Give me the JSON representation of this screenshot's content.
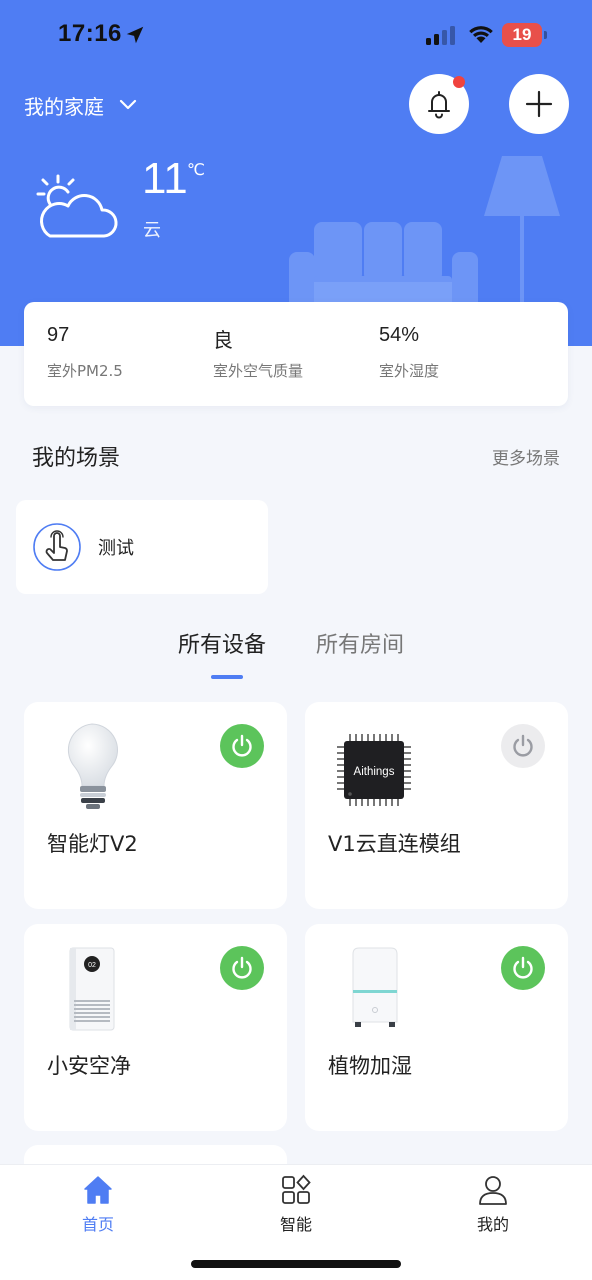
{
  "status_bar": {
    "time": "17:16",
    "battery": "19",
    "icons": [
      "location-arrow-icon",
      "signal-icon",
      "wifi-icon",
      "battery-icon"
    ]
  },
  "header": {
    "home_name": "我的家庭",
    "icons": [
      "chevron-down-icon",
      "bell-icon",
      "plus-icon"
    ],
    "notification_dot_color": "#f0433e"
  },
  "weather": {
    "temperature": "11",
    "unit": "℃",
    "description": "云",
    "icon": "partly-cloudy-icon"
  },
  "air_quality": [
    {
      "value": "97",
      "label": "室外PM2.5"
    },
    {
      "value": "良",
      "label": "室外空气质量"
    },
    {
      "value": "54%",
      "label": "室外湿度"
    }
  ],
  "scenes": {
    "title": "我的场景",
    "more": "更多场景",
    "items": [
      {
        "name": "测试",
        "icon": "tap-hand-icon"
      }
    ]
  },
  "tabs": {
    "devices": "所有设备",
    "rooms": "所有房间",
    "active": "devices"
  },
  "devices": [
    {
      "name": "智能灯V2",
      "image": "light-bulb",
      "power": "on"
    },
    {
      "name": "V1云直连模组",
      "image": "chip",
      "chip_label": "Aithings",
      "power": "off"
    },
    {
      "name": "小安空净",
      "image": "air-purifier",
      "display": "02",
      "power": "on"
    },
    {
      "name": "植物加湿",
      "image": "humidifier",
      "power": "on"
    }
  ],
  "bottom_nav": [
    {
      "label": "首页",
      "icon": "home-icon",
      "active": true
    },
    {
      "label": "智能",
      "icon": "grid-icon",
      "active": false
    },
    {
      "label": "我的",
      "icon": "user-icon",
      "active": false
    }
  ],
  "colors": {
    "primary": "#4f7df3",
    "power_on": "#5cc45b",
    "power_off": "#ececee",
    "background": "#f4f6fb"
  }
}
